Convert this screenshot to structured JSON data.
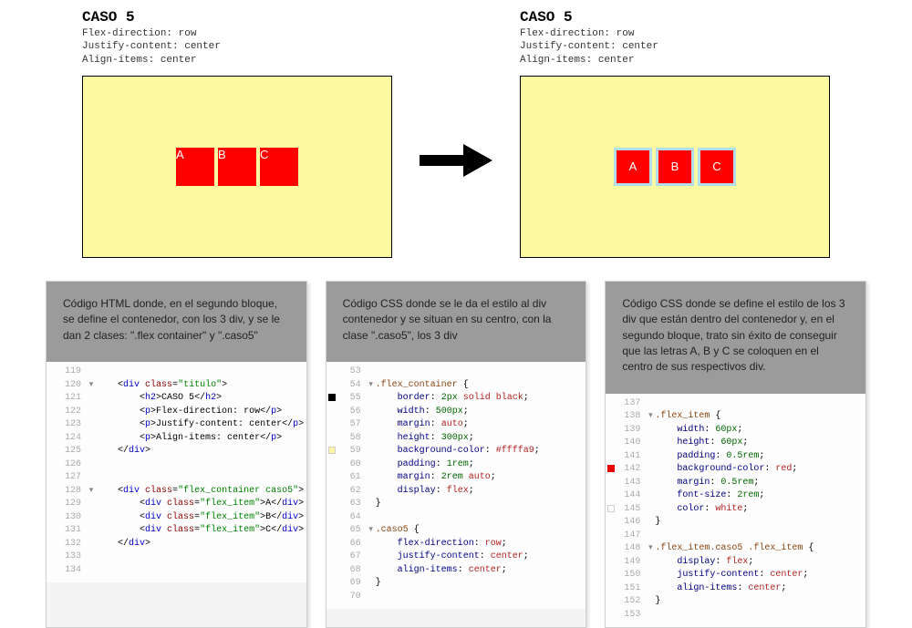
{
  "caso_title": "CASO 5",
  "caso_lines": [
    "Flex-direction: row",
    "Justify-content: center",
    "Align-items: center"
  ],
  "items": [
    "A",
    "B",
    "C"
  ],
  "panels": {
    "html": {
      "desc": "Código HTML donde, en el segundo bloque, se define el contenedor, con los 3 div, y se le dan 2 clases: \".flex container\" y \".caso5\""
    },
    "css1": {
      "desc": "Código CSS donde se le da el estilo al div contenedor y se situan en su centro, con la clase \".caso5\", los 3 div"
    },
    "css2": {
      "desc": "Código CSS donde se define el estilo de los 3 div que están dentro del contenedor y, en el segundo bloque, trato sin éxito de conseguir que las letras A, B y C se coloquen en el centro de sus respectivos div."
    }
  },
  "code_html": [
    {
      "n": 119,
      "fold": "",
      "s": []
    },
    {
      "n": 120,
      "fold": "▾",
      "s": [
        {
          "c": "c-punc",
          "t": "    <"
        },
        {
          "c": "c-tag",
          "t": "div "
        },
        {
          "c": "c-attr",
          "t": "class"
        },
        {
          "c": "c-punc",
          "t": "="
        },
        {
          "c": "c-str",
          "t": "\"titulo\""
        },
        {
          "c": "c-punc",
          "t": ">"
        }
      ]
    },
    {
      "n": 121,
      "fold": "",
      "s": [
        {
          "c": "c-punc",
          "t": "        <"
        },
        {
          "c": "c-tag",
          "t": "h2"
        },
        {
          "c": "c-punc",
          "t": ">"
        },
        {
          "c": "c-text",
          "t": "CASO 5"
        },
        {
          "c": "c-punc",
          "t": "</"
        },
        {
          "c": "c-tag",
          "t": "h2"
        },
        {
          "c": "c-punc",
          "t": ">"
        }
      ]
    },
    {
      "n": 122,
      "fold": "",
      "s": [
        {
          "c": "c-punc",
          "t": "        <"
        },
        {
          "c": "c-tag",
          "t": "p"
        },
        {
          "c": "c-punc",
          "t": ">"
        },
        {
          "c": "c-text",
          "t": "Flex-direction: row"
        },
        {
          "c": "c-punc",
          "t": "</"
        },
        {
          "c": "c-tag",
          "t": "p"
        },
        {
          "c": "c-punc",
          "t": ">"
        }
      ]
    },
    {
      "n": 123,
      "fold": "",
      "s": [
        {
          "c": "c-punc",
          "t": "        <"
        },
        {
          "c": "c-tag",
          "t": "p"
        },
        {
          "c": "c-punc",
          "t": ">"
        },
        {
          "c": "c-text",
          "t": "Justify-content: center"
        },
        {
          "c": "c-punc",
          "t": "</"
        },
        {
          "c": "c-tag",
          "t": "p"
        },
        {
          "c": "c-punc",
          "t": ">"
        }
      ]
    },
    {
      "n": 124,
      "fold": "",
      "s": [
        {
          "c": "c-punc",
          "t": "        <"
        },
        {
          "c": "c-tag",
          "t": "p"
        },
        {
          "c": "c-punc",
          "t": ">"
        },
        {
          "c": "c-text",
          "t": "Align-items: center"
        },
        {
          "c": "c-punc",
          "t": "</"
        },
        {
          "c": "c-tag",
          "t": "p"
        },
        {
          "c": "c-punc",
          "t": ">"
        }
      ]
    },
    {
      "n": 125,
      "fold": "",
      "s": [
        {
          "c": "c-punc",
          "t": "    </"
        },
        {
          "c": "c-tag",
          "t": "div"
        },
        {
          "c": "c-punc",
          "t": ">"
        }
      ]
    },
    {
      "n": 126,
      "fold": "",
      "s": []
    },
    {
      "n": 127,
      "fold": "",
      "s": []
    },
    {
      "n": 128,
      "fold": "▾",
      "s": [
        {
          "c": "c-punc",
          "t": "    <"
        },
        {
          "c": "c-tag",
          "t": "div "
        },
        {
          "c": "c-attr",
          "t": "class"
        },
        {
          "c": "c-punc",
          "t": "="
        },
        {
          "c": "c-str",
          "t": "\"flex_container caso5\""
        },
        {
          "c": "c-punc",
          "t": ">"
        }
      ]
    },
    {
      "n": 129,
      "fold": "",
      "s": [
        {
          "c": "c-punc",
          "t": "        <"
        },
        {
          "c": "c-tag",
          "t": "div "
        },
        {
          "c": "c-attr",
          "t": "class"
        },
        {
          "c": "c-punc",
          "t": "="
        },
        {
          "c": "c-str",
          "t": "\"flex_item\""
        },
        {
          "c": "c-punc",
          "t": ">"
        },
        {
          "c": "c-text",
          "t": "A"
        },
        {
          "c": "c-punc",
          "t": "</"
        },
        {
          "c": "c-tag",
          "t": "div"
        },
        {
          "c": "c-punc",
          "t": ">"
        }
      ]
    },
    {
      "n": 130,
      "fold": "",
      "s": [
        {
          "c": "c-punc",
          "t": "        <"
        },
        {
          "c": "c-tag",
          "t": "div "
        },
        {
          "c": "c-attr",
          "t": "class"
        },
        {
          "c": "c-punc",
          "t": "="
        },
        {
          "c": "c-str",
          "t": "\"flex_item\""
        },
        {
          "c": "c-punc",
          "t": ">"
        },
        {
          "c": "c-text",
          "t": "B"
        },
        {
          "c": "c-punc",
          "t": "</"
        },
        {
          "c": "c-tag",
          "t": "div"
        },
        {
          "c": "c-punc",
          "t": ">"
        }
      ]
    },
    {
      "n": 131,
      "fold": "",
      "s": [
        {
          "c": "c-punc",
          "t": "        <"
        },
        {
          "c": "c-tag",
          "t": "div "
        },
        {
          "c": "c-attr",
          "t": "class"
        },
        {
          "c": "c-punc",
          "t": "="
        },
        {
          "c": "c-str",
          "t": "\"flex_item\""
        },
        {
          "c": "c-punc",
          "t": ">"
        },
        {
          "c": "c-text",
          "t": "C"
        },
        {
          "c": "c-punc",
          "t": "</"
        },
        {
          "c": "c-tag",
          "t": "div"
        },
        {
          "c": "c-punc",
          "t": ">"
        }
      ]
    },
    {
      "n": 132,
      "fold": "",
      "s": [
        {
          "c": "c-punc",
          "t": "    </"
        },
        {
          "c": "c-tag",
          "t": "div"
        },
        {
          "c": "c-punc",
          "t": ">"
        }
      ]
    },
    {
      "n": 133,
      "fold": "",
      "s": []
    },
    {
      "n": 134,
      "fold": "",
      "s": []
    }
  ],
  "code_css1": [
    {
      "n": 53,
      "mark": "",
      "s": []
    },
    {
      "n": 54,
      "mark": "",
      "fold": "▾",
      "s": [
        {
          "c": "c-sel",
          "t": ".flex_container"
        },
        {
          "c": "c-punc",
          "t": " {"
        }
      ]
    },
    {
      "n": 55,
      "mark": "black",
      "s": [
        {
          "c": "c-prop",
          "t": "    border"
        },
        {
          "c": "c-punc",
          "t": ": "
        },
        {
          "c": "c-num",
          "t": "2px"
        },
        {
          "c": "c-val",
          "t": " solid black"
        },
        {
          "c": "c-punc",
          "t": ";"
        }
      ]
    },
    {
      "n": 56,
      "mark": "",
      "s": [
        {
          "c": "c-prop",
          "t": "    width"
        },
        {
          "c": "c-punc",
          "t": ": "
        },
        {
          "c": "c-num",
          "t": "500px"
        },
        {
          "c": "c-punc",
          "t": ";"
        }
      ]
    },
    {
      "n": 57,
      "mark": "",
      "s": [
        {
          "c": "c-prop",
          "t": "    margin"
        },
        {
          "c": "c-punc",
          "t": ": "
        },
        {
          "c": "c-val",
          "t": "auto"
        },
        {
          "c": "c-punc",
          "t": ";"
        }
      ]
    },
    {
      "n": 58,
      "mark": "",
      "s": [
        {
          "c": "c-prop",
          "t": "    height"
        },
        {
          "c": "c-punc",
          "t": ": "
        },
        {
          "c": "c-num",
          "t": "300px"
        },
        {
          "c": "c-punc",
          "t": ";"
        }
      ]
    },
    {
      "n": 59,
      "mark": "yellow",
      "s": [
        {
          "c": "c-prop",
          "t": "    background-color"
        },
        {
          "c": "c-punc",
          "t": ": "
        },
        {
          "c": "c-val",
          "t": "#ffffa9"
        },
        {
          "c": "c-punc",
          "t": ";"
        }
      ]
    },
    {
      "n": 60,
      "mark": "",
      "s": [
        {
          "c": "c-prop",
          "t": "    padding"
        },
        {
          "c": "c-punc",
          "t": ": "
        },
        {
          "c": "c-num",
          "t": "1rem"
        },
        {
          "c": "c-punc",
          "t": ";"
        }
      ]
    },
    {
      "n": 61,
      "mark": "",
      "s": [
        {
          "c": "c-prop",
          "t": "    margin"
        },
        {
          "c": "c-punc",
          "t": ": "
        },
        {
          "c": "c-num",
          "t": "2rem"
        },
        {
          "c": "c-val",
          "t": " auto"
        },
        {
          "c": "c-punc",
          "t": ";"
        }
      ]
    },
    {
      "n": 62,
      "mark": "",
      "s": [
        {
          "c": "c-prop",
          "t": "    display"
        },
        {
          "c": "c-punc",
          "t": ": "
        },
        {
          "c": "c-val",
          "t": "flex"
        },
        {
          "c": "c-punc",
          "t": ";"
        }
      ]
    },
    {
      "n": 63,
      "mark": "",
      "s": [
        {
          "c": "c-punc",
          "t": "}"
        }
      ]
    },
    {
      "n": 64,
      "mark": "",
      "s": []
    },
    {
      "n": 65,
      "mark": "",
      "fold": "▾",
      "s": [
        {
          "c": "c-sel",
          "t": ".caso5"
        },
        {
          "c": "c-punc",
          "t": " {"
        }
      ]
    },
    {
      "n": 66,
      "mark": "",
      "s": [
        {
          "c": "c-prop",
          "t": "    flex-direction"
        },
        {
          "c": "c-punc",
          "t": ": "
        },
        {
          "c": "c-val",
          "t": "row"
        },
        {
          "c": "c-punc",
          "t": ";"
        }
      ]
    },
    {
      "n": 67,
      "mark": "",
      "s": [
        {
          "c": "c-prop",
          "t": "    justify-content"
        },
        {
          "c": "c-punc",
          "t": ": "
        },
        {
          "c": "c-val",
          "t": "center"
        },
        {
          "c": "c-punc",
          "t": ";"
        }
      ]
    },
    {
      "n": 68,
      "mark": "",
      "s": [
        {
          "c": "c-prop",
          "t": "    align-items"
        },
        {
          "c": "c-punc",
          "t": ": "
        },
        {
          "c": "c-val",
          "t": "center"
        },
        {
          "c": "c-punc",
          "t": ";"
        }
      ]
    },
    {
      "n": 69,
      "mark": "",
      "s": [
        {
          "c": "c-punc",
          "t": "}"
        }
      ]
    },
    {
      "n": 70,
      "mark": "",
      "s": []
    }
  ],
  "code_css2": [
    {
      "n": 137,
      "mark": "",
      "s": []
    },
    {
      "n": 138,
      "mark": "",
      "fold": "▾",
      "s": [
        {
          "c": "c-sel",
          "t": ".flex_item"
        },
        {
          "c": "c-punc",
          "t": " {"
        }
      ]
    },
    {
      "n": 139,
      "mark": "",
      "s": [
        {
          "c": "c-prop",
          "t": "    width"
        },
        {
          "c": "c-punc",
          "t": ": "
        },
        {
          "c": "c-num",
          "t": "60px"
        },
        {
          "c": "c-punc",
          "t": ";"
        }
      ]
    },
    {
      "n": 140,
      "mark": "",
      "s": [
        {
          "c": "c-prop",
          "t": "    height"
        },
        {
          "c": "c-punc",
          "t": ": "
        },
        {
          "c": "c-num",
          "t": "60px"
        },
        {
          "c": "c-punc",
          "t": ";"
        }
      ]
    },
    {
      "n": 141,
      "mark": "",
      "s": [
        {
          "c": "c-prop",
          "t": "    padding"
        },
        {
          "c": "c-punc",
          "t": ": "
        },
        {
          "c": "c-num",
          "t": "0.5rem"
        },
        {
          "c": "c-punc",
          "t": ";"
        }
      ]
    },
    {
      "n": 142,
      "mark": "red",
      "s": [
        {
          "c": "c-prop",
          "t": "    background-color"
        },
        {
          "c": "c-punc",
          "t": ": "
        },
        {
          "c": "c-val",
          "t": "red"
        },
        {
          "c": "c-punc",
          "t": ";"
        }
      ]
    },
    {
      "n": 143,
      "mark": "",
      "s": [
        {
          "c": "c-prop",
          "t": "    margin"
        },
        {
          "c": "c-punc",
          "t": ": "
        },
        {
          "c": "c-num",
          "t": "0.5rem"
        },
        {
          "c": "c-punc",
          "t": ";"
        }
      ]
    },
    {
      "n": 144,
      "mark": "",
      "s": [
        {
          "c": "c-prop",
          "t": "    font-size"
        },
        {
          "c": "c-punc",
          "t": ": "
        },
        {
          "c": "c-num",
          "t": "2rem"
        },
        {
          "c": "c-punc",
          "t": ";"
        }
      ]
    },
    {
      "n": 145,
      "mark": "white",
      "s": [
        {
          "c": "c-prop",
          "t": "    color"
        },
        {
          "c": "c-punc",
          "t": ": "
        },
        {
          "c": "c-val",
          "t": "white"
        },
        {
          "c": "c-punc",
          "t": ";"
        }
      ]
    },
    {
      "n": 146,
      "mark": "",
      "s": [
        {
          "c": "c-punc",
          "t": "}"
        }
      ]
    },
    {
      "n": 147,
      "mark": "",
      "s": []
    },
    {
      "n": 148,
      "mark": "",
      "fold": "▾",
      "s": [
        {
          "c": "c-sel",
          "t": ".flex_item.caso5 .flex_item"
        },
        {
          "c": "c-punc",
          "t": " {"
        }
      ]
    },
    {
      "n": 149,
      "mark": "",
      "s": [
        {
          "c": "c-prop",
          "t": "    display"
        },
        {
          "c": "c-punc",
          "t": ": "
        },
        {
          "c": "c-val",
          "t": "flex"
        },
        {
          "c": "c-punc",
          "t": ";"
        }
      ]
    },
    {
      "n": 150,
      "mark": "",
      "s": [
        {
          "c": "c-prop",
          "t": "    justify-content"
        },
        {
          "c": "c-punc",
          "t": ": "
        },
        {
          "c": "c-val",
          "t": "center"
        },
        {
          "c": "c-punc",
          "t": ";"
        }
      ]
    },
    {
      "n": 151,
      "mark": "",
      "s": [
        {
          "c": "c-prop",
          "t": "    align-items"
        },
        {
          "c": "c-punc",
          "t": ": "
        },
        {
          "c": "c-val",
          "t": "center"
        },
        {
          "c": "c-punc",
          "t": ";"
        }
      ]
    },
    {
      "n": 152,
      "mark": "",
      "s": [
        {
          "c": "c-punc",
          "t": "}"
        }
      ]
    },
    {
      "n": 153,
      "mark": "",
      "s": []
    }
  ]
}
